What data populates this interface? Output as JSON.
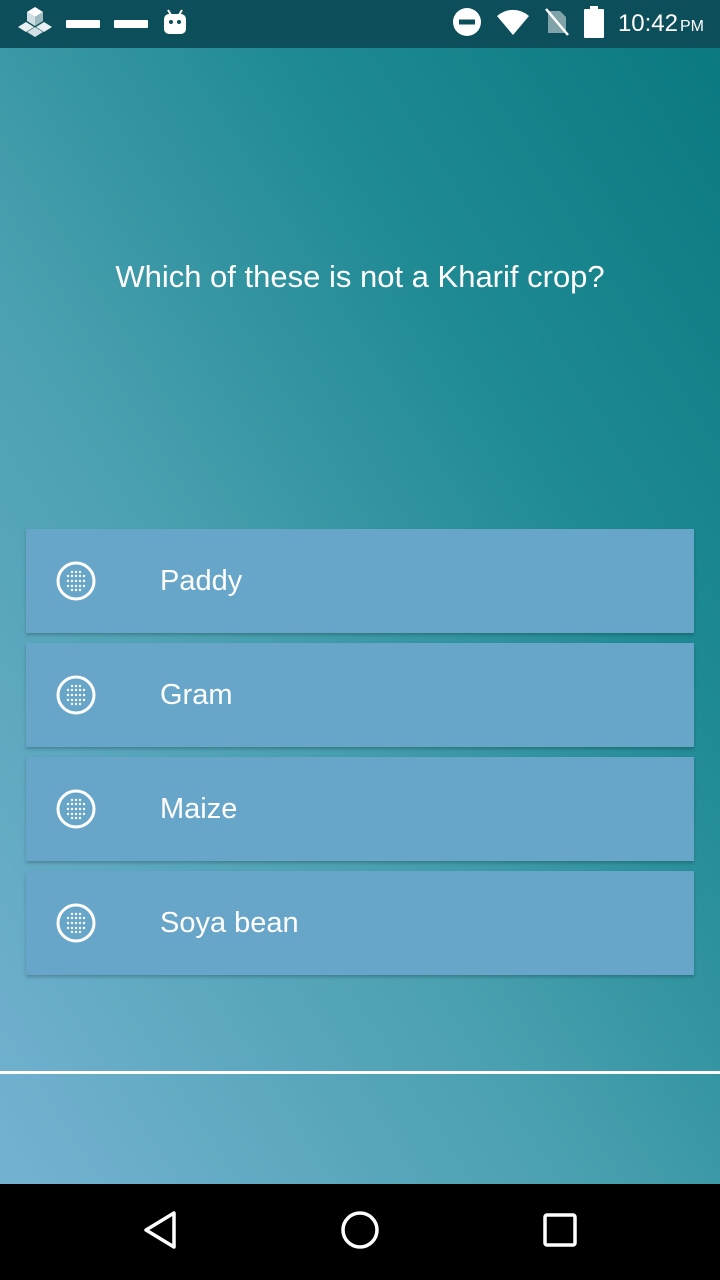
{
  "status_bar": {
    "time": "10:42",
    "ampm": "PM",
    "left_icons": [
      "app-icon",
      "notification-bar-icon",
      "notification-bar-icon",
      "android-icon"
    ],
    "right_icons": [
      "do-not-disturb-icon",
      "wifi-icon",
      "no-sim-icon",
      "battery-icon"
    ]
  },
  "quiz": {
    "question": "Which of these is not a Kharif crop?",
    "options": [
      {
        "label": "Paddy"
      },
      {
        "label": "Gram"
      },
      {
        "label": "Maize"
      },
      {
        "label": "Soya bean"
      }
    ]
  },
  "nav_bar": {
    "buttons": [
      "back-icon",
      "home-icon",
      "recents-icon"
    ]
  },
  "colors": {
    "status_bar": "#0c4f5a",
    "option_bg": "#68a6c9",
    "text": "#ffffff",
    "nav_bar": "#000000"
  }
}
